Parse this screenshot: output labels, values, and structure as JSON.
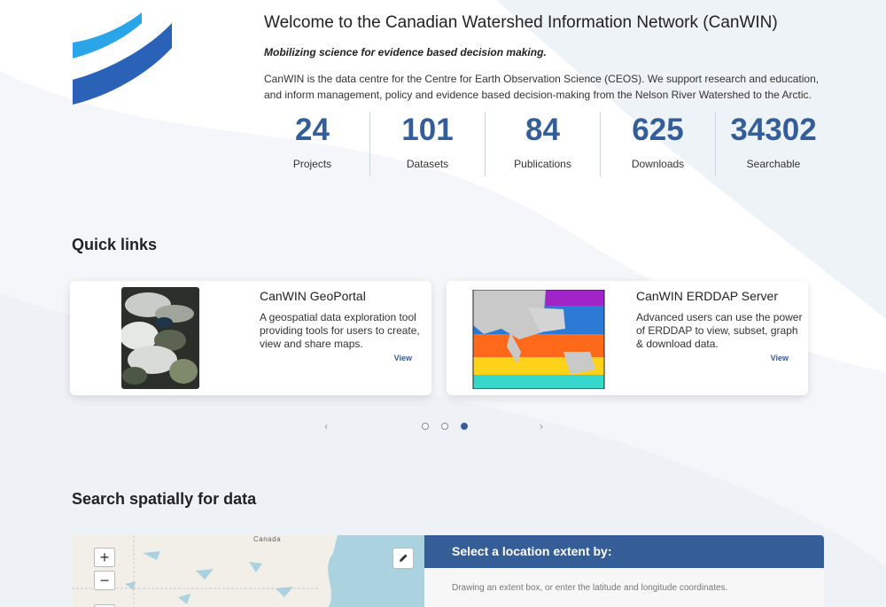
{
  "header": {
    "title": "Welcome to the Canadian Watershed Information Network (CanWIN)",
    "tagline": "Mobilizing science for evidence based decision making.",
    "description": "CanWIN is the data centre for the Centre for Earth Observation Science (CEOS). We support research and education, and inform management, policy and evidence based decision-making from the Nelson River Watershed to the Arctic."
  },
  "stats": [
    {
      "value": "24",
      "label": "Projects"
    },
    {
      "value": "101",
      "label": "Datasets"
    },
    {
      "value": "84",
      "label": "Publications"
    },
    {
      "value": "625",
      "label": "Downloads"
    },
    {
      "value": "34302",
      "label": "Searchable"
    }
  ],
  "quick_links": {
    "title": "Quick links",
    "cards": [
      {
        "title": "CanWIN GeoPortal",
        "description": "A geospatial data exploration tool providing tools for users to create, view and share maps.",
        "link_label": "View",
        "image": "satellite-image-hudson-bay"
      },
      {
        "title": "CanWIN ERDDAP Server",
        "description": "Advanced users can use the power of ERDDAP to view, subset, graph & download data.",
        "link_label": "View",
        "image": "sea-surface-temperature-map"
      }
    ],
    "carousel": {
      "prev_label": "‹",
      "next_label": "›",
      "dots": 3,
      "active_dot": 3
    }
  },
  "spatial_search": {
    "title": "Search spatially for data",
    "map": {
      "zoom_in_label": "+",
      "zoom_out_label": "−",
      "place_label": "Canada",
      "edit_icon": "pencil-icon"
    },
    "panel": {
      "heading": "Select a location extent by:",
      "text": "Drawing an extent box, or enter the latitude and longitude coordinates."
    }
  },
  "colors": {
    "accent": "#355e99",
    "logo_light": "#2aa6e8",
    "logo_dark": "#2a62b8",
    "panel_header": "#355e99"
  }
}
